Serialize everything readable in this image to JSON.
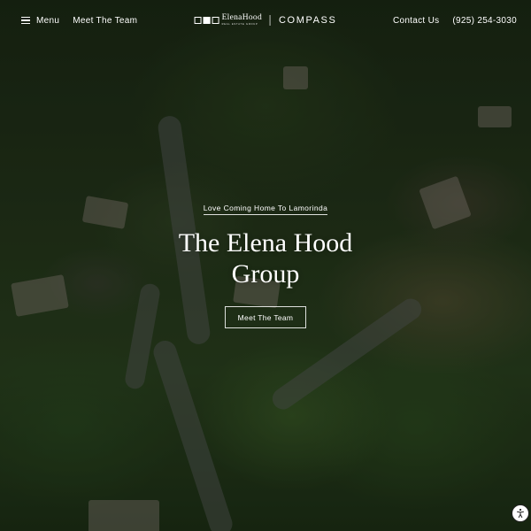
{
  "header": {
    "menu_label": "Menu",
    "nav_left": [
      "Meet The Team"
    ],
    "logo_name": "ElenaHood",
    "logo_sub": "REAL ESTATE GROUP",
    "compass_logo": "COMPASS",
    "contact_label": "Contact Us",
    "phone": "(925) 254-3030"
  },
  "hero": {
    "tagline": "Love Coming Home To Lamorinda",
    "title": "The Elena Hood Group",
    "cta_label": "Meet The Team"
  },
  "icons": {
    "menu": "hamburger-icon",
    "accessibility": "accessibility-icon"
  },
  "colors": {
    "text": "#ffffff",
    "overlay": "#000000"
  }
}
